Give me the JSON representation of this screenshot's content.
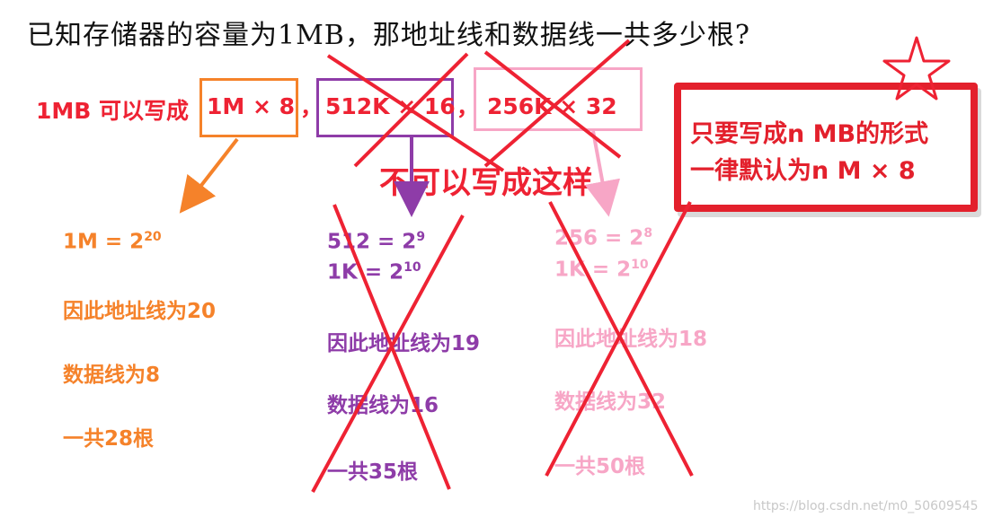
{
  "question": "已知存储器的容量为1MB，那地址线和数据线一共多少根?",
  "intro": "1MB 可以写成",
  "options": [
    {
      "text": "1M × 8",
      "color": "#f5822a"
    },
    {
      "text": "512K × 16",
      "color": "#8e3ca8"
    },
    {
      "text": "256K × 32",
      "color": "#f7a6c6"
    }
  ],
  "separator": "，",
  "warning": "不可以写成这样",
  "rule": {
    "line1": "只要写成n MB的形式",
    "line2": "一律默认为n M × 8"
  },
  "col1": {
    "eq_base": "1M = 2",
    "eq_exp": "20",
    "address": "因此地址线为20",
    "data": "数据线为8",
    "total": "一共28根"
  },
  "col2": {
    "eq1_base": "512 = 2",
    "eq1_exp": "9",
    "eq2_base": "1K = 2",
    "eq2_exp": "10",
    "address": "因此地址线为19",
    "data": "数据线为16",
    "total": "一共35根"
  },
  "col3": {
    "eq1_base": "256 = 2",
    "eq1_exp": "8",
    "eq2_base": "1K = 2",
    "eq2_exp": "10",
    "address": "因此地址线为18",
    "data": "数据线为32",
    "total": "一共50根"
  },
  "watermark": "https://blog.csdn.net/m0_50609545"
}
